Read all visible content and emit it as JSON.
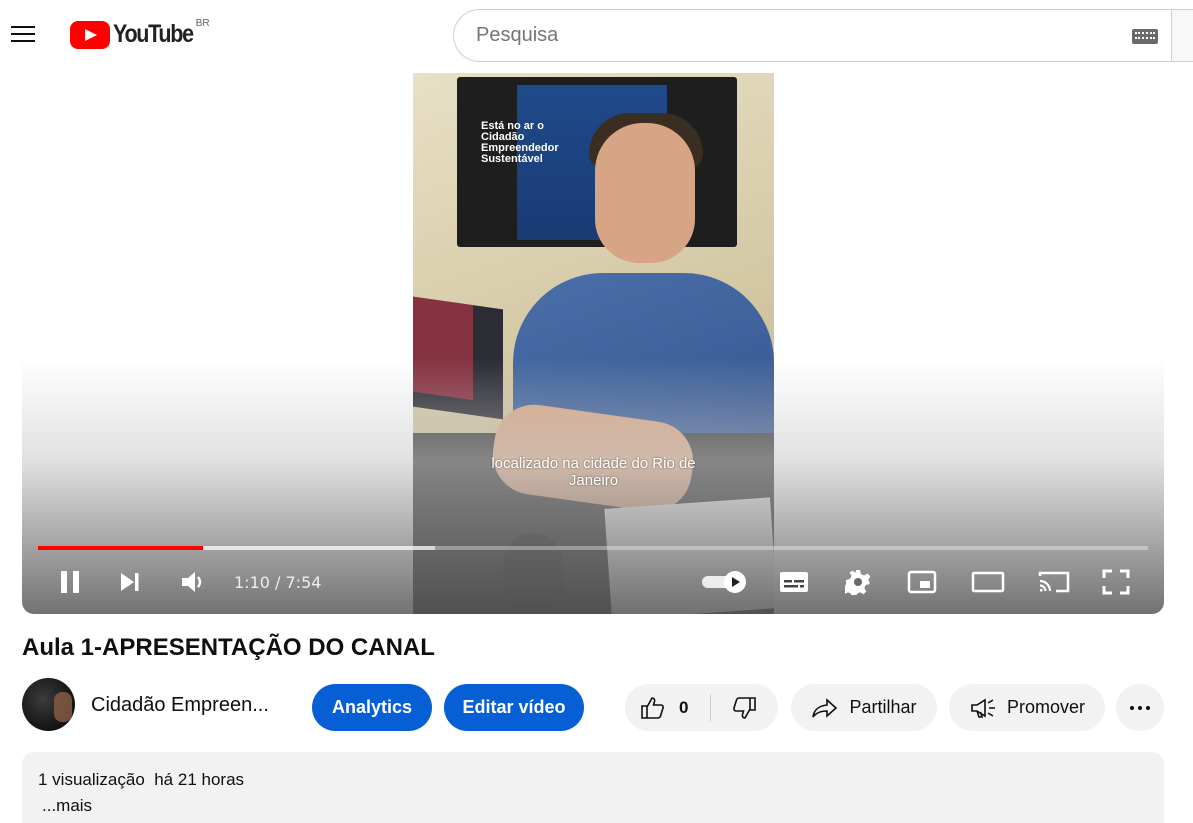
{
  "header": {
    "logo_text": "YouTube",
    "region": "BR",
    "search_placeholder": "Pesquisa"
  },
  "player": {
    "caption_line1": "localizado na cidade do Rio de",
    "caption_line2": "Janeiro",
    "tv_text": "Está no ar o Cidadão Empreendedor Sustentável",
    "time_display": "1:10 / 7:54",
    "progress_played_fraction": 0.149,
    "progress_loaded_fraction": 0.358
  },
  "video": {
    "title": "Aula 1-APRESENTAÇÃO DO CANAL"
  },
  "owner": {
    "channel_name": "Cidadão Empreen...",
    "analytics_label": "Analytics",
    "edit_label": "Editar vídeo"
  },
  "actions": {
    "like_count": "0",
    "share_label": "Partilhar",
    "promote_label": "Promover"
  },
  "description": {
    "meta": "1 visualização  há 21 horas",
    "more": "...mais"
  },
  "colors": {
    "brand_red": "#ff0000",
    "accent_blue": "#065fd4",
    "pill_gray": "#f2f2f2"
  }
}
